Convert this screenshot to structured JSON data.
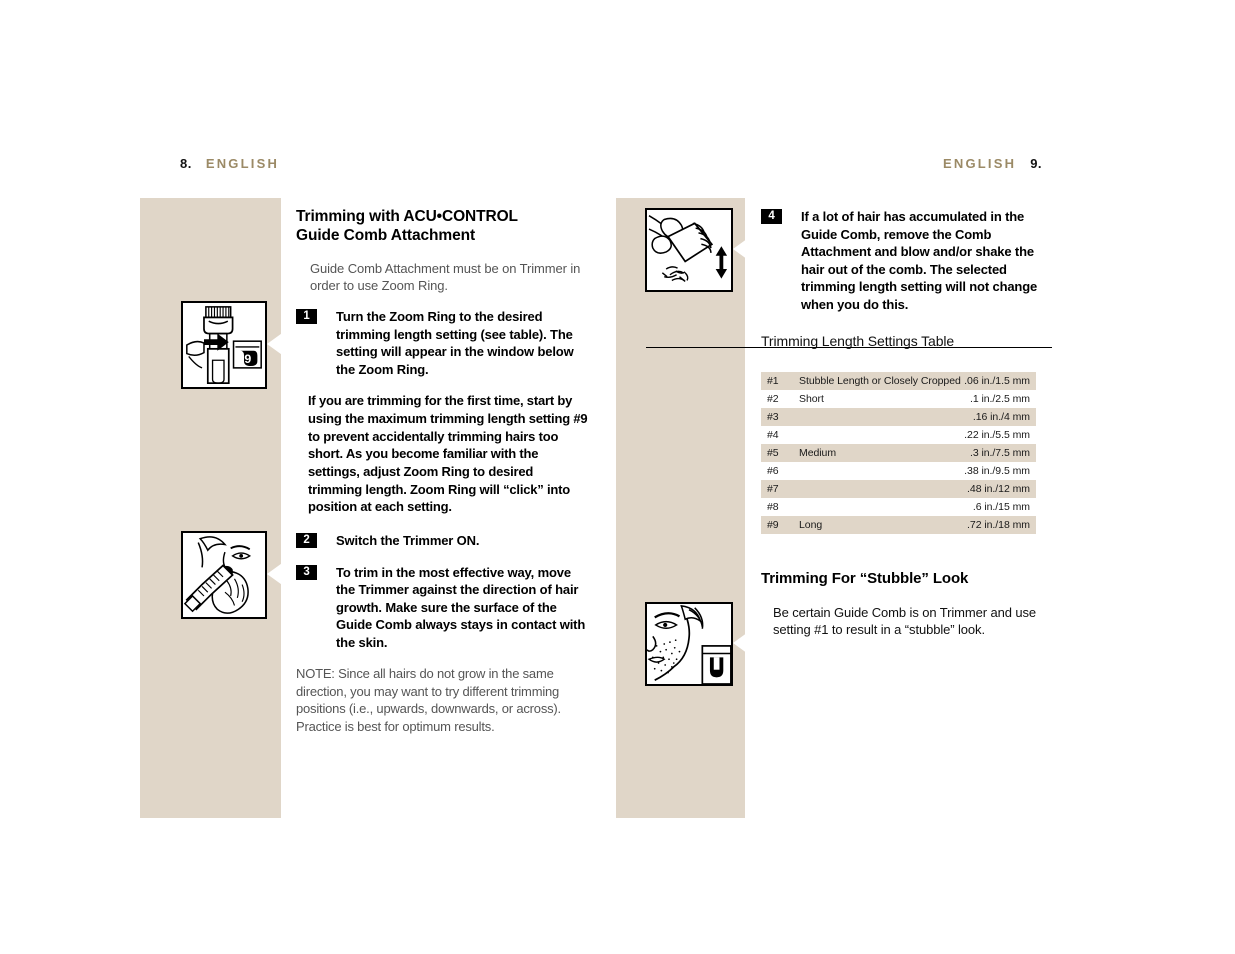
{
  "headers": {
    "left_page_number": "8.",
    "left_language": "ENGLISH",
    "right_language": "ENGLISH",
    "right_page_number": "9."
  },
  "colors": {
    "band_beige": "#E0D6C8",
    "heading_gold": "#9B8A66",
    "table_shade": "#E0D6C8",
    "badge_black": "#000000"
  },
  "left_column": {
    "title_line1": "Trimming with ACU•CONTROL",
    "title_line2": "Guide Comb Attachment",
    "lead": "Guide Comb Attachment must be on Trimmer in order to use Zoom Ring.",
    "step1_number": "1",
    "step1_text": "Turn the Zoom Ring to the desired trimming length setting (see table). The setting will appear in the window below the Zoom Ring.",
    "paragraph": "If you are trimming for the first time, start by using the maximum trimming length setting #9 to prevent accidentally trimming hairs too short. As you become familiar with the settings, adjust Zoom Ring to desired trimming length. Zoom Ring will “click” into position at each setting.",
    "step2_number": "2",
    "step2_text": "Switch the Trimmer ON.",
    "step3_number": "3",
    "step3_text": "To trim in the most effective way, move the Trimmer against the direction of hair growth. Make sure the surface of the Guide Comb always stays in contact with the skin.",
    "note": "NOTE:  Since all hairs do not grow in the same direction, you may want to try different trimming positions (i.e., upwards, downwards, or across). Practice is best for optimum results."
  },
  "right_column": {
    "step4_number": "4",
    "step4_text": "If a lot of hair has accumulated in the Guide Comb, remove the Comb Attachment and blow and/or shake the hair out of the comb.  The selected trimming length setting will not change when you do this.",
    "table_heading": "Trimming Length Settings Table",
    "stubble_title": "Trimming For “Stubble” Look",
    "stubble_body": "Be certain Guide Comb is on Trimmer and use setting #1 to result in a “stubble” look."
  },
  "settings_table": {
    "rows": [
      {
        "number": "#1",
        "description": "Stubble Length or Closely Cropped",
        "length": ".06 in./1.5 mm",
        "shaded": true
      },
      {
        "number": "#2",
        "description": "Short",
        "length": ".1 in./2.5 mm",
        "shaded": false
      },
      {
        "number": "#3",
        "description": "",
        "length": ".16 in./4 mm",
        "shaded": true
      },
      {
        "number": "#4",
        "description": "",
        "length": ".22 in./5.5 mm",
        "shaded": false
      },
      {
        "number": "#5",
        "description": "Medium",
        "length": ".3 in./7.5 mm",
        "shaded": true
      },
      {
        "number": "#6",
        "description": "",
        "length": ".38 in./9.5 mm",
        "shaded": false
      },
      {
        "number": "#7",
        "description": "",
        "length": ".48 in./12 mm",
        "shaded": true
      },
      {
        "number": "#8",
        "description": "",
        "length": ".6 in./15 mm",
        "shaded": false
      },
      {
        "number": "#9",
        "description": "Long",
        "length": ".72 in./18 mm",
        "shaded": true
      }
    ]
  },
  "illustrations": {
    "trimmer_zoom_ring": "trimmer-zoom-ring-setting-9-illustration",
    "trimming_beard": "trimming-beard-illustration",
    "shake_comb": "shake-hair-from-comb-illustration",
    "stubble_face": "stubble-look-face-illustration",
    "zoom_window_value": "9",
    "stubble_window_value": "1"
  }
}
